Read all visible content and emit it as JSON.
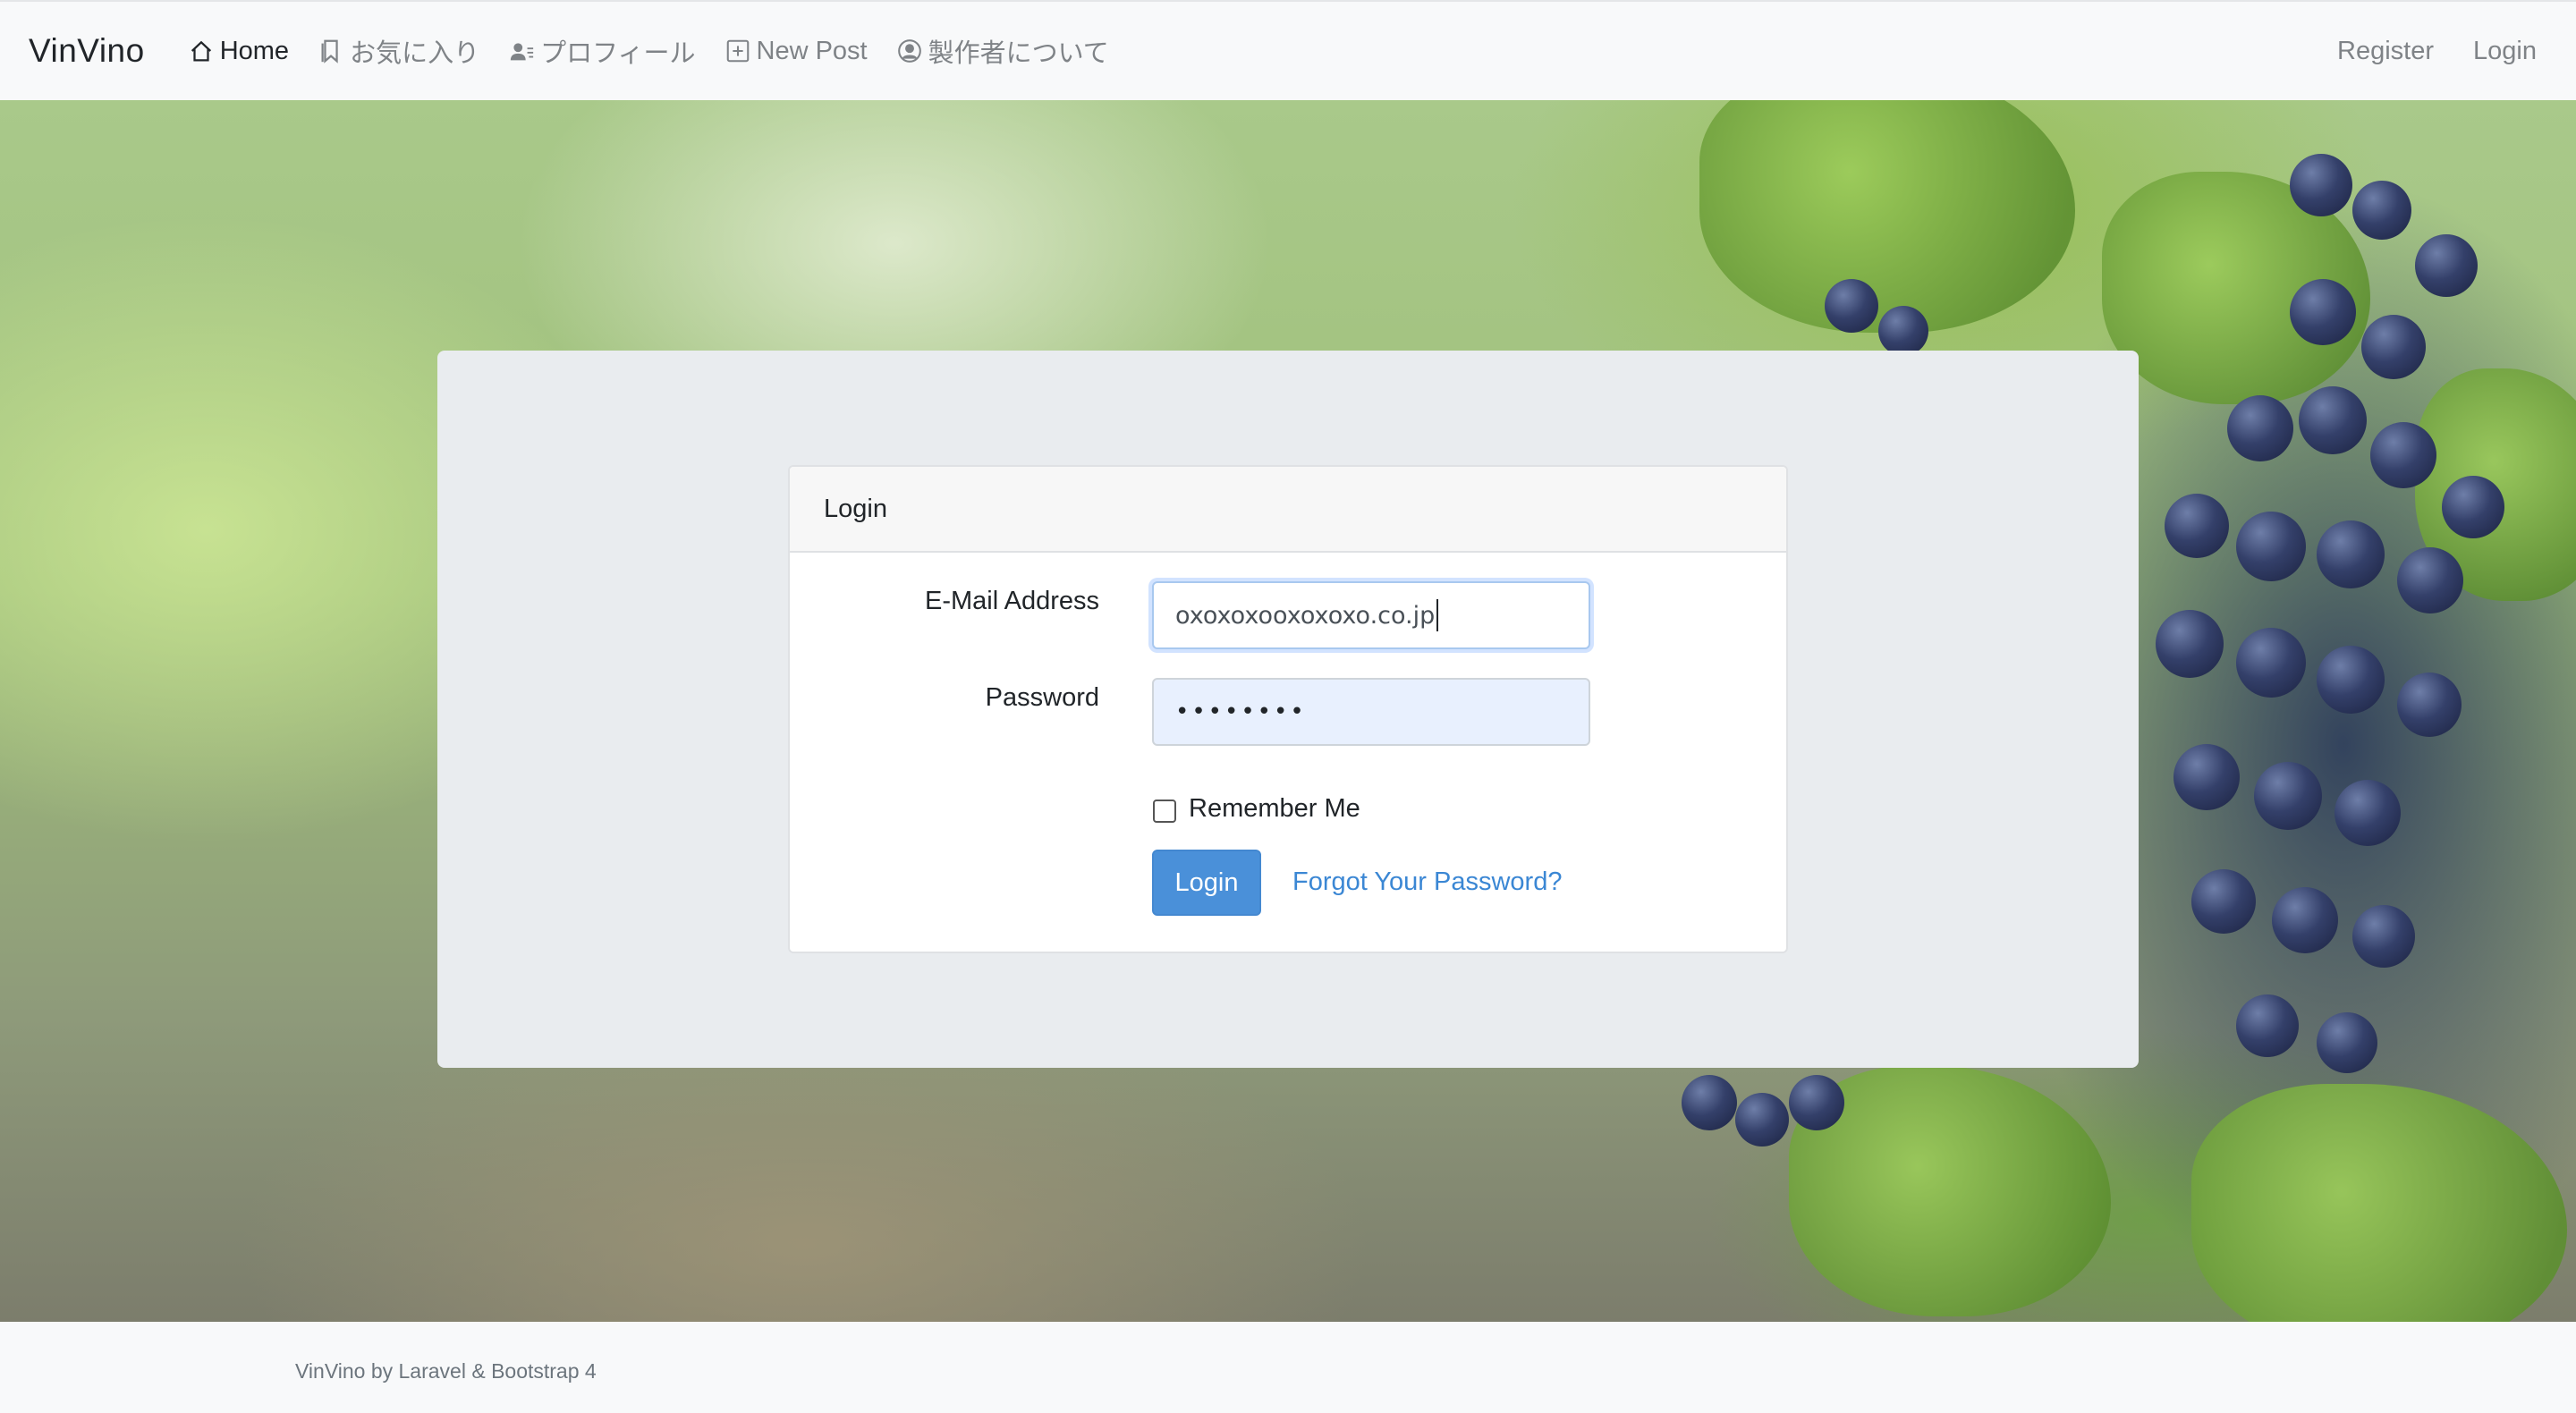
{
  "navbar": {
    "brand": "VinVino",
    "items": [
      {
        "label": "Home",
        "icon": "home-icon",
        "active": true
      },
      {
        "label": "お気に入り",
        "icon": "bookmark-icon",
        "active": false
      },
      {
        "label": "プロフィール",
        "icon": "person-lines-icon",
        "active": false
      },
      {
        "label": "New Post",
        "icon": "plus-square-icon",
        "active": false
      },
      {
        "label": "製作者について",
        "icon": "person-circle-icon",
        "active": false
      }
    ],
    "right": [
      {
        "label": "Register"
      },
      {
        "label": "Login"
      }
    ]
  },
  "login_card": {
    "header": "Login",
    "email_label": "E-Mail Address",
    "email_value": "oxoxoxooxoxoxo.co.jp",
    "password_label": "Password",
    "password_value": "••••••••",
    "remember_label": "Remember Me",
    "remember_checked": false,
    "submit_label": "Login",
    "forgot_label": "Forgot Your Password?"
  },
  "footer": {
    "text": "VinVino by Laravel & Bootstrap 4"
  },
  "colors": {
    "primary": "#4a90d9",
    "link": "#3b87d4",
    "navbar_bg": "#f8f9fa",
    "panel_bg": "#e9ecef"
  }
}
